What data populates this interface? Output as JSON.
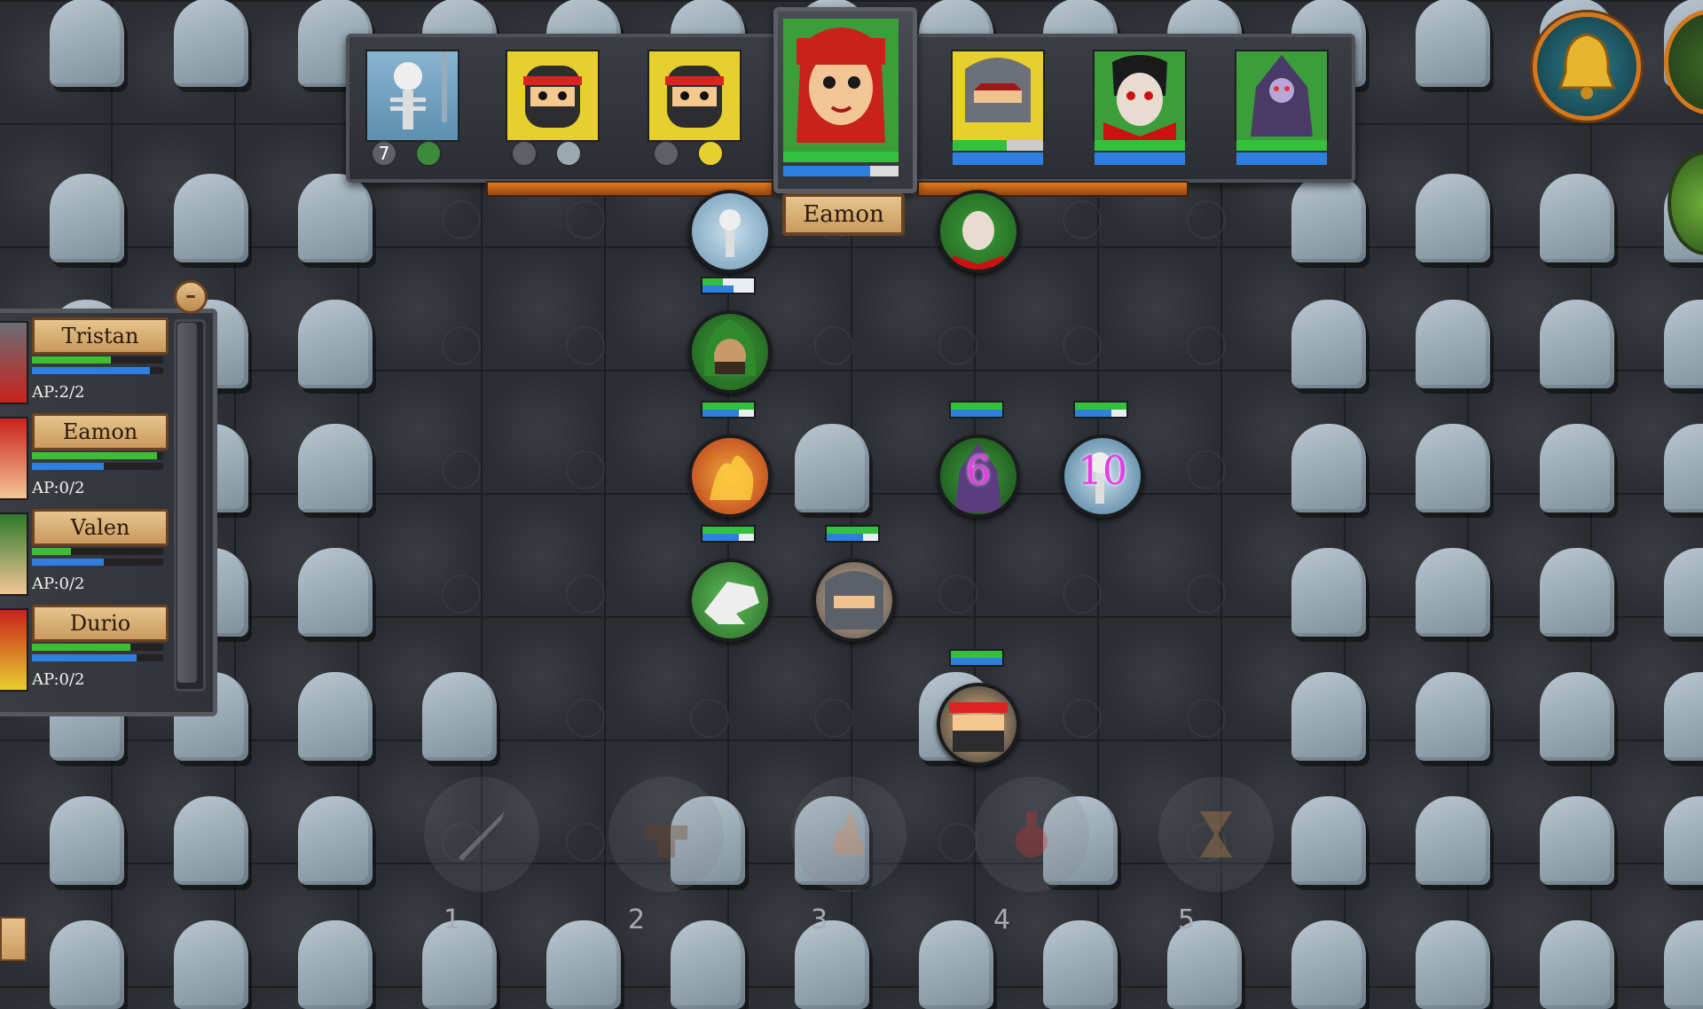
{
  "turn_order": {
    "active_name": "Eamon",
    "portraits": [
      {
        "id": "skeleton",
        "hp": 0,
        "mp": 0,
        "badge": "7"
      },
      {
        "id": "ninja-red-1",
        "hp": 0,
        "mp": 0
      },
      {
        "id": "ninja-red-2",
        "hp": 0,
        "mp": 0
      },
      {
        "id": "knight-gray",
        "hp": 0.6,
        "mp": 1.0
      },
      {
        "id": "vampire",
        "hp": 1.0,
        "mp": 1.0
      },
      {
        "id": "lich",
        "hp": 1.0,
        "mp": 1.0
      }
    ],
    "active_hp": 1.0,
    "active_mp": 0.75
  },
  "party": [
    {
      "name": "Tristan",
      "ap": "AP:2/2",
      "hp": 0.6,
      "mp": 0.9
    },
    {
      "name": "Eamon",
      "ap": "AP:0/2",
      "hp": 0.95,
      "mp": 0.55
    },
    {
      "name": "Valen",
      "ap": "AP:0/2",
      "hp": 0.3,
      "mp": 0.55
    },
    {
      "name": "Durio",
      "ap": "AP:0/2",
      "hp": 0.75,
      "mp": 0.8
    }
  ],
  "tokens": [
    {
      "id": "skeleton-ally",
      "label": "",
      "color": "#9cc3d8"
    },
    {
      "id": "hooded-ranger",
      "label": "",
      "color": "#2f7a2a"
    },
    {
      "id": "fire-mage",
      "label": "",
      "color": "#b8391c"
    },
    {
      "id": "dragon-skeleton",
      "label": "",
      "color": "#3d8a3a"
    },
    {
      "id": "ninja-gray",
      "label": "",
      "color": "#4a4d55"
    },
    {
      "id": "vampire-enemy",
      "label": "",
      "color": "#a82020"
    },
    {
      "id": "lich-enemy",
      "label": "6",
      "color": "#5b3c7e"
    },
    {
      "id": "skeleton-enemy",
      "label": "10",
      "color": "#6e99b8"
    },
    {
      "id": "ninja-red-enemy",
      "label": "",
      "color": "#3a3a3e"
    }
  ],
  "hotbar": [
    "1",
    "2",
    "3",
    "4",
    "5"
  ],
  "colors": {
    "accent": "#d4781e",
    "hp": "#33c03c",
    "mp": "#2f7fe0",
    "namebox": "#c99a5e"
  }
}
